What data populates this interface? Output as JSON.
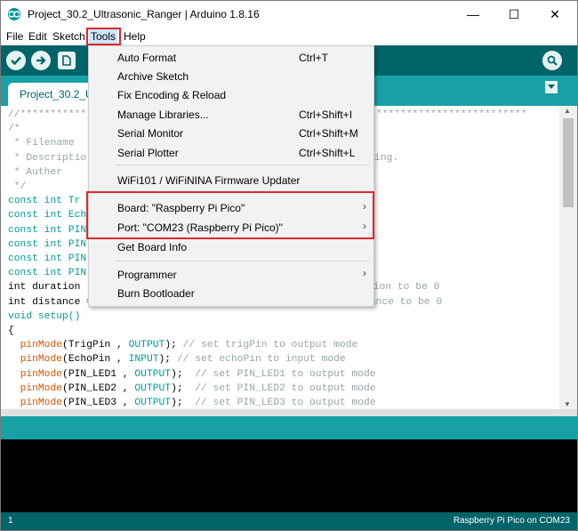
{
  "window": {
    "title": "Project_30.2_Ultrasonic_Ranger | Arduino 1.8.16",
    "minimize": "—",
    "maximize": "☐",
    "close": "✕"
  },
  "menubar": [
    "File",
    "Edit",
    "Sketch",
    "Tools",
    "Help"
  ],
  "tab": {
    "label": "Project_30.2_Ultrasonic_Ranger"
  },
  "tools_menu": {
    "items": [
      {
        "label": "Auto Format",
        "shortcut": "Ctrl+T"
      },
      {
        "label": "Archive Sketch",
        "shortcut": ""
      },
      {
        "label": "Fix Encoding & Reload",
        "shortcut": ""
      },
      {
        "label": "Manage Libraries...",
        "shortcut": "Ctrl+Shift+I"
      },
      {
        "label": "Serial Monitor",
        "shortcut": "Ctrl+Shift+M"
      },
      {
        "label": "Serial Plotter",
        "shortcut": "Ctrl+Shift+L"
      },
      {
        "label": "WiFi101 / WiFiNINA Firmware Updater",
        "shortcut": ""
      },
      {
        "label": "Board: \"Raspberry Pi Pico\"",
        "shortcut": ""
      },
      {
        "label": "Port: \"COM23 (Raspberry Pi Pico)\"",
        "shortcut": ""
      },
      {
        "label": "Get Board Info",
        "shortcut": ""
      },
      {
        "label": "Programmer",
        "shortcut": ""
      },
      {
        "label": "Burn Bootloader",
        "shortcut": ""
      }
    ],
    "submenu_arrow": "›"
  },
  "code": {
    "lines": [
      "//***********",
      "/*",
      " * Filename",
      " * Descriptio",
      " * Auther",
      " */",
      "const int Tr",
      "const int Ech",
      "const int PIN",
      "const int PIN",
      "const int PIN",
      "const int PIN",
      "int duration",
      "int distance = 0;    // define the initial value of the distance to be 0",
      "void setup()",
      "{",
      "  pinMode(TrigPin , OUTPUT); // set trigPin to output mode",
      "  pinMode(EchoPin , INPUT); // set echoPin to input mode",
      "  pinMode(PIN_LED1 , OUTPUT);  // set PIN_LED1 to output mode",
      "  pinMode(PIN_LED2 , OUTPUT);  // set PIN_LED2 to output mode",
      "  pinMode(PIN_LED3 , OUTPUT);  // set PIN_LED3 to output mode"
    ],
    "right_fragments": {
      "stars": "*************************",
      "ing": "ing.",
      "duration_tail": "tion to be 0"
    }
  },
  "status_bar": {
    "line_number": "1",
    "board_port": "Raspberry Pi Pico on COM23"
  },
  "colors": {
    "toolbar": "#006468",
    "tabs": "#17a1a5",
    "highlight": "#e0282e"
  }
}
